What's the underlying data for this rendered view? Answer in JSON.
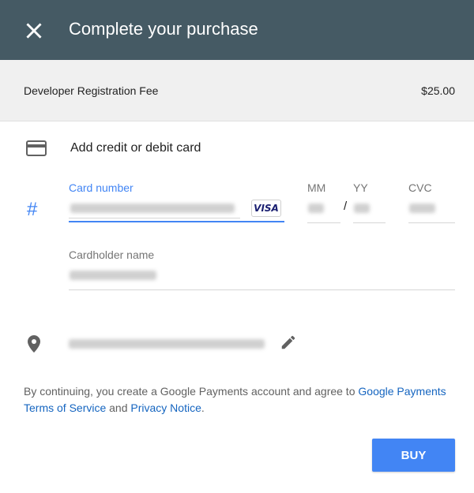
{
  "header": {
    "title": "Complete your purchase",
    "close_icon": "close-icon",
    "background": "#455a64"
  },
  "order": {
    "item": "Developer Registration Fee",
    "price": "$25.00"
  },
  "payment": {
    "section_title": "Add credit or debit card",
    "card_number_label": "Card number",
    "card_brand": "VISA",
    "mm_label": "MM",
    "yy_label": "YY",
    "date_separator": "/",
    "cvc_label": "CVC",
    "cardholder_label": "Cardholder name",
    "accent_color": "#4285f4"
  },
  "terms": {
    "prefix": "By continuing, you create a Google Payments account and agree to ",
    "tos_link": "Google Payments Terms of Service",
    "middle": " and ",
    "privacy_link": "Privacy Notice",
    "suffix": "."
  },
  "actions": {
    "buy_label": "BUY"
  }
}
